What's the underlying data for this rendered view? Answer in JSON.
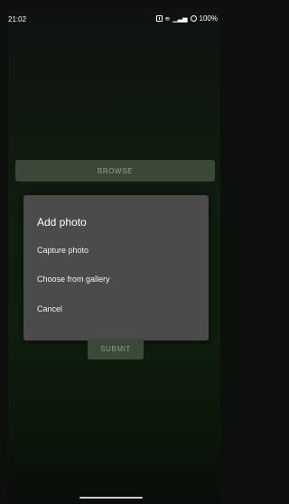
{
  "status_bar": {
    "time": "21:02",
    "icons": [
      "nfc-icon",
      "vibrate-icon",
      "signal-icon",
      "battery-icon"
    ],
    "battery": "100%"
  },
  "form": {
    "browse_label": "BROWSE",
    "submit_label": "SUBMIT"
  },
  "dialog": {
    "title": "Add photo",
    "options": [
      "Capture photo",
      "Choose from gallery",
      "Cancel"
    ]
  },
  "colors": {
    "background_top": "#0e1210",
    "background_mid": "#0f1d0f",
    "dialog_bg": "#4b4b4b",
    "button_bg": "#3b4838"
  }
}
